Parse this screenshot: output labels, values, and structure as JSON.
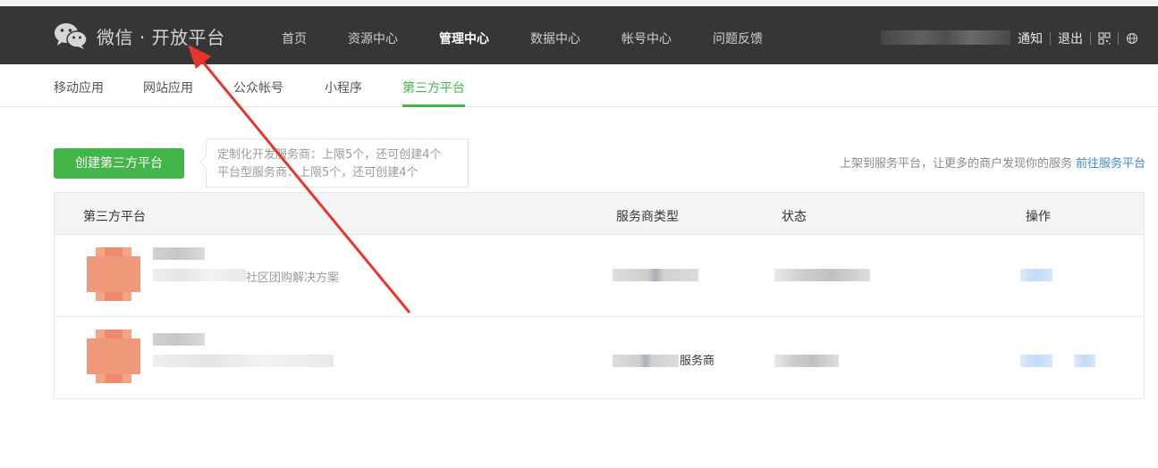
{
  "header": {
    "logo_text": "微信 · 开放平台",
    "nav": [
      {
        "label": "首页",
        "active": false
      },
      {
        "label": "资源中心",
        "active": false
      },
      {
        "label": "管理中心",
        "active": true
      },
      {
        "label": "数据中心",
        "active": false
      },
      {
        "label": "帐号中心",
        "active": false
      },
      {
        "label": "问题反馈",
        "active": false
      }
    ],
    "notify_label": "通知",
    "logout_label": "退出"
  },
  "subnav": {
    "items": [
      {
        "label": "移动应用",
        "active": false
      },
      {
        "label": "网站应用",
        "active": false
      },
      {
        "label": "公众帐号",
        "active": false
      },
      {
        "label": "小程序",
        "active": false
      },
      {
        "label": "第三方平台",
        "active": true
      }
    ]
  },
  "toolbar": {
    "create_label": "创建第三方平台",
    "tip_line1": "定制化开发服务商：上限5个，还可创建4个",
    "tip_line2": "平台型服务商：上限5个，还可创建4个",
    "promo_text": "上架到服务平台，让更多的商户发现你的服务",
    "promo_link": "前往服务平台"
  },
  "table": {
    "columns": [
      "第三方平台",
      "服务商类型",
      "状态",
      "操作"
    ],
    "rows": [
      {
        "desc_visible": "社区团购解决方案",
        "type_visible": ""
      },
      {
        "desc_visible": "",
        "type_visible": "服务商"
      }
    ]
  },
  "colors": {
    "topbar": "#363636",
    "accent_green": "#44b549",
    "link_blue": "#3f87d6",
    "annotation_red": "#e8352b"
  }
}
